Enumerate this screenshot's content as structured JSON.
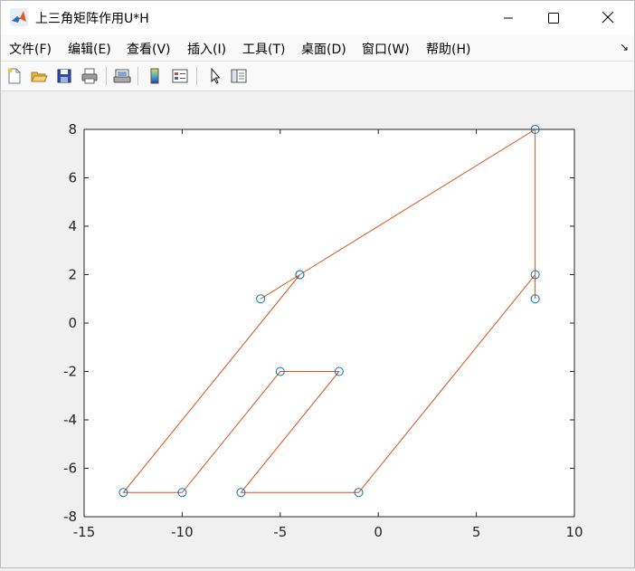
{
  "window": {
    "title": "上三角矩阵作用U*H"
  },
  "menu": {
    "items": [
      {
        "label": "文件(F)"
      },
      {
        "label": "编辑(E)"
      },
      {
        "label": "查看(V)"
      },
      {
        "label": "插入(I)"
      },
      {
        "label": "工具(T)"
      },
      {
        "label": "桌面(D)"
      },
      {
        "label": "窗口(W)"
      },
      {
        "label": "帮助(H)"
      }
    ],
    "overflow_arrow": "↘"
  },
  "toolbar": {
    "icons": [
      "new-figure-icon",
      "open-file-icon",
      "save-icon",
      "print-icon",
      "link-plot-icon",
      "colorbar-icon",
      "legend-icon",
      "pointer-icon",
      "property-inspector-icon"
    ]
  },
  "colors": {
    "line": "#d95319",
    "marker": "#0072bd",
    "axes_bg": "#ffffff",
    "figure_bg": "#f0f0f0"
  },
  "chart_data": {
    "type": "line",
    "xlim": [
      -15,
      10
    ],
    "ylim": [
      -8,
      8
    ],
    "xticks": [
      -15,
      -10,
      -5,
      0,
      5,
      10
    ],
    "yticks": [
      -8,
      -6,
      -4,
      -2,
      0,
      2,
      4,
      6,
      8
    ],
    "xticklabels": [
      "-15",
      "-10",
      "-5",
      "0",
      "5",
      "10"
    ],
    "yticklabels": [
      "-8",
      "-6",
      "-4",
      "-2",
      "0",
      "2",
      "4",
      "6",
      "8"
    ],
    "grid": false,
    "series": [
      {
        "marker": "circle",
        "x": [
          -6,
          -4,
          8,
          8,
          8,
          -1,
          -7,
          -2,
          -5,
          -10,
          -13,
          -4
        ],
        "y": [
          1,
          2,
          8,
          1,
          2,
          -7,
          -7,
          -2,
          -2,
          -7,
          -7,
          2
        ]
      }
    ]
  }
}
